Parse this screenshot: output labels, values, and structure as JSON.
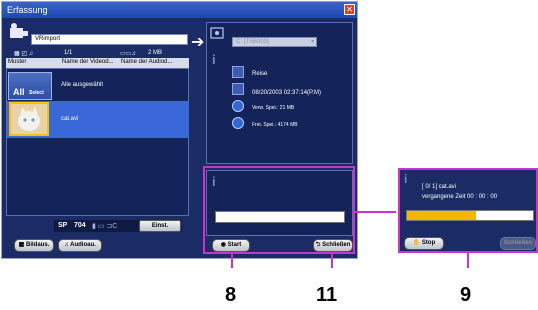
{
  "window": {
    "title": "Erfassung",
    "close_glyph": "✕"
  },
  "left": {
    "folder_name": "VRimport",
    "count": "1/1",
    "capacity": "2 MB",
    "columns": [
      "Muster",
      "Name der Videod...",
      "Name der Audiod..."
    ],
    "all_select_label": "Alle ausgewählt",
    "all_badge": "All",
    "select_badge": "Select",
    "file_name": "cat.avi",
    "sp_label": "SP",
    "sp_value": "704",
    "einst_label": "Einst.",
    "bildaus_label": "Bildaus.",
    "audioau_label": "Audioau."
  },
  "right": {
    "drive_label": "C: [TSB003]",
    "rows": [
      {
        "icon": "folder-icon",
        "text": "Reise"
      },
      {
        "icon": "calendar-icon",
        "text": "08/20/2003 02:37:14(P.M)"
      },
      {
        "icon": "disk-used-icon",
        "text": "Verw. Spei.: 21 MB"
      },
      {
        "icon": "disk-free-icon",
        "text": "Frei. Spei.: 4174 MB"
      }
    ],
    "start_label": "Start",
    "schliessen_label": "Schließen"
  },
  "popup": {
    "progress_count": "[ 0/ 1] cat.avi",
    "elapsed": "vergangene Zeit 00 : 00 : 00",
    "progress_fraction": 0.55,
    "stop_label": "Stop",
    "schliessen_label": "Schließen"
  },
  "callouts": {
    "start": "8",
    "schliessen": "11",
    "stop": "9"
  },
  "colors": {
    "callout": "#cc33cc",
    "progress": "#f2b705",
    "panel": "#1b2b66"
  }
}
